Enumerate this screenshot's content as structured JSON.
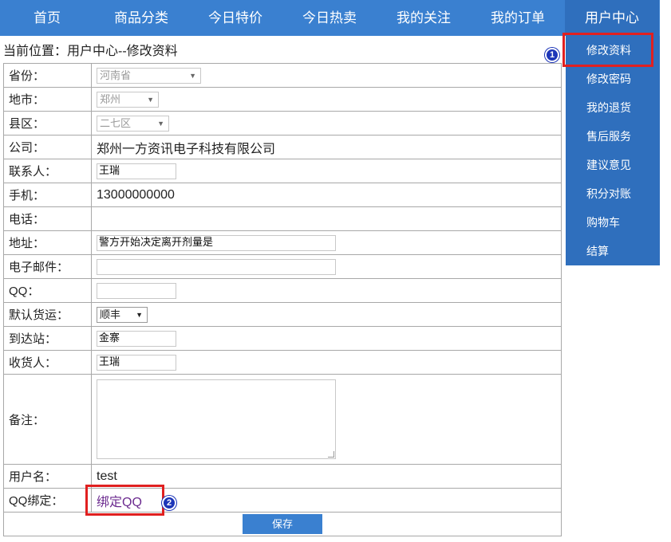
{
  "nav": {
    "items": [
      "首页",
      "商品分类",
      "今日特价",
      "今日热卖",
      "我的关注",
      "我的订单",
      "用户中心"
    ]
  },
  "breadcrumb": "当前位置：用户中心--修改资料",
  "dropdown": {
    "items": [
      "修改资料",
      "修改密码",
      "我的退货",
      "售后服务",
      "建议意见",
      "积分对账",
      "购物车",
      "结算"
    ]
  },
  "annotations": {
    "badge1": "1",
    "badge2": "2",
    "highlight_color": "#e02020",
    "badge_color": "#1c35b8"
  },
  "form": {
    "province_label": "省份：",
    "province_value": "河南省",
    "city_label": "地市：",
    "city_value": "郑州",
    "district_label": "县区：",
    "district_value": "二七区",
    "company_label": "公司：",
    "company_value": "郑州一方资讯电子科技有限公司",
    "contact_label": "联系人：",
    "contact_value": "王瑞",
    "mobile_label": "手机：",
    "mobile_value": "13000000000",
    "phone_label": "电话：",
    "address_label": "地址：",
    "address_value": "警方开始决定离开剂量是",
    "email_label": "电子邮件：",
    "email_value": "",
    "qq_label": "QQ：",
    "qq_value": "",
    "shipping_label": "默认货运：",
    "shipping_value": "顺丰",
    "station_label": "到达站：",
    "station_value": "金寨",
    "receiver_label": "收货人：",
    "receiver_value": "王瑞",
    "notes_label": "备注：",
    "username_label": "用户名：",
    "username_value": "test",
    "qqbind_label": "QQ绑定：",
    "qqbind_link": "绑定QQ",
    "save_label": "保存"
  },
  "colors": {
    "nav_bg": "#3a80d0",
    "dropdown_bg": "#2f6fbd"
  }
}
